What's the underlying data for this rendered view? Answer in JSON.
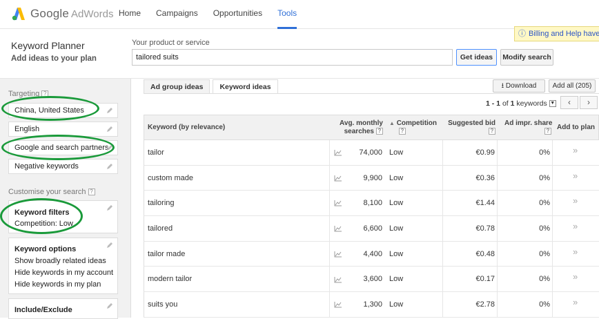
{
  "header": {
    "logo_google": "Google",
    "logo_adwords": "AdWords",
    "nav": [
      "Home",
      "Campaigns",
      "Opportunities",
      "Tools"
    ],
    "active_nav": "Tools",
    "billing_notice": "Billing and Help have r"
  },
  "planner": {
    "title": "Keyword Planner",
    "subtitle": "Add ideas to your plan",
    "product_label": "Your product or service",
    "product_value": "tailored suits",
    "get_ideas": "Get ideas",
    "modify_search": "Modify search"
  },
  "sidebar": {
    "targeting_label": "Targeting",
    "targeting": [
      "China, United States",
      "English",
      "Google and search partners",
      "Negative keywords"
    ],
    "customise_label": "Customise your search",
    "keyword_filters_title": "Keyword filters",
    "keyword_filters_value": "Competition: Low",
    "keyword_options_title": "Keyword options",
    "keyword_options": [
      "Show broadly related ideas",
      "Hide keywords in my account",
      "Hide keywords in my plan"
    ],
    "include_exclude_title": "Include/Exclude"
  },
  "results": {
    "tabs": [
      "Ad group ideas",
      "Keyword ideas"
    ],
    "active_tab": "Keyword ideas",
    "download": "Download",
    "add_all": "Add all (205)",
    "pager_range": "1 - 1",
    "pager_of": "of",
    "pager_total": "1",
    "pager_unit": "keywords",
    "columns": {
      "keyword": "Keyword (by relevance)",
      "searches_1": "Avg. monthly",
      "searches_2": "searches",
      "competition": "Competition",
      "bid": "Suggested bid",
      "share": "Ad impr. share",
      "add": "Add to plan"
    },
    "rows": [
      {
        "keyword": "tailor",
        "searches": "74,000",
        "competition": "Low",
        "bid": "€0.99",
        "share": "0%"
      },
      {
        "keyword": "custom made",
        "searches": "9,900",
        "competition": "Low",
        "bid": "€0.36",
        "share": "0%"
      },
      {
        "keyword": "tailoring",
        "searches": "8,100",
        "competition": "Low",
        "bid": "€1.44",
        "share": "0%"
      },
      {
        "keyword": "tailored",
        "searches": "6,600",
        "competition": "Low",
        "bid": "€0.78",
        "share": "0%"
      },
      {
        "keyword": "tailor made",
        "searches": "4,400",
        "competition": "Low",
        "bid": "€0.48",
        "share": "0%"
      },
      {
        "keyword": "modern tailor",
        "searches": "3,600",
        "competition": "Low",
        "bid": "€0.17",
        "share": "0%"
      },
      {
        "keyword": "suits you",
        "searches": "1,300",
        "competition": "Low",
        "bid": "€2.78",
        "share": "0%"
      }
    ]
  },
  "colors": {
    "accent": "#2f6fd7",
    "annotation": "#1a9a3a",
    "billing_bg": "#fff8c5"
  }
}
